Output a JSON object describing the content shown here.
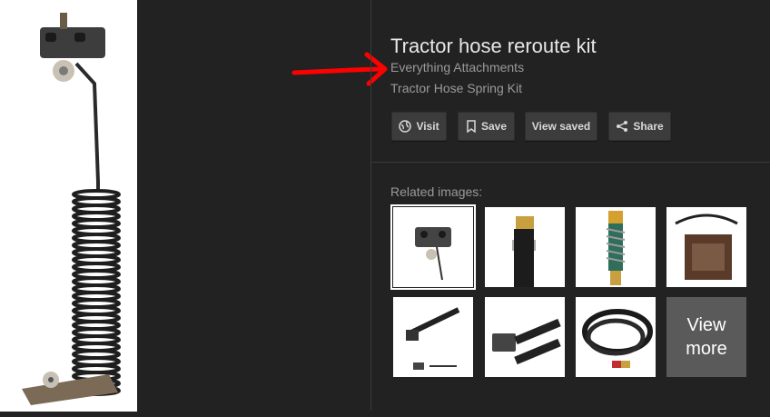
{
  "header": {
    "title": "Tractor hose reroute kit",
    "source": "Everything Attachments",
    "subtitle": "Tractor Hose Spring Kit"
  },
  "actions": {
    "visit": "Visit",
    "save": "Save",
    "view_saved": "View saved",
    "share": "Share"
  },
  "related": {
    "label": "Related images:",
    "view_more": "View more"
  },
  "colors": {
    "background": "#222222",
    "annotation_arrow": "#ff0000",
    "button_bg": "#3c3c3c"
  }
}
